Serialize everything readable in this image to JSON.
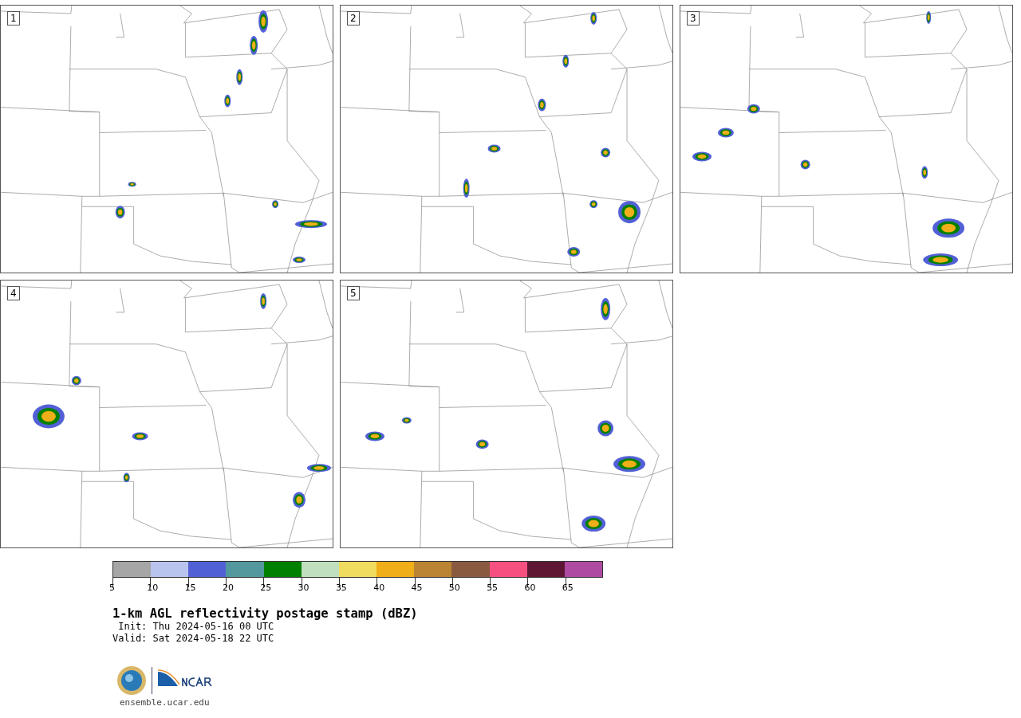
{
  "panels": [
    {
      "label": "1"
    },
    {
      "label": "2"
    },
    {
      "label": "3"
    },
    {
      "label": "4"
    },
    {
      "label": "5"
    }
  ],
  "colorbar": {
    "segments": [
      {
        "color": "#a6a6a6",
        "label": "5"
      },
      {
        "color": "#b8c4ee",
        "label": "10"
      },
      {
        "color": "#5260d6",
        "label": "15"
      },
      {
        "color": "#52989c",
        "label": "20"
      },
      {
        "color": "#008000",
        "label": "25"
      },
      {
        "color": "#bfdfbf",
        "label": "30"
      },
      {
        "color": "#f0dc5e",
        "label": "35"
      },
      {
        "color": "#f0ae18",
        "label": "40"
      },
      {
        "color": "#ba8432",
        "label": "45"
      },
      {
        "color": "#8a5a40",
        "label": "50"
      },
      {
        "color": "#f65080",
        "label": "55"
      },
      {
        "color": "#5e1634",
        "label": "60"
      },
      {
        "color": "#ae4aa2",
        "label": "65"
      }
    ]
  },
  "title": "1-km AGL reflectivity postage stamp (dBZ)",
  "init": " Init: Thu 2024-05-16 00 UTC",
  "valid": "Valid: Sat 2024-05-18 22 UTC",
  "url": "ensemble.ucar.edu"
}
